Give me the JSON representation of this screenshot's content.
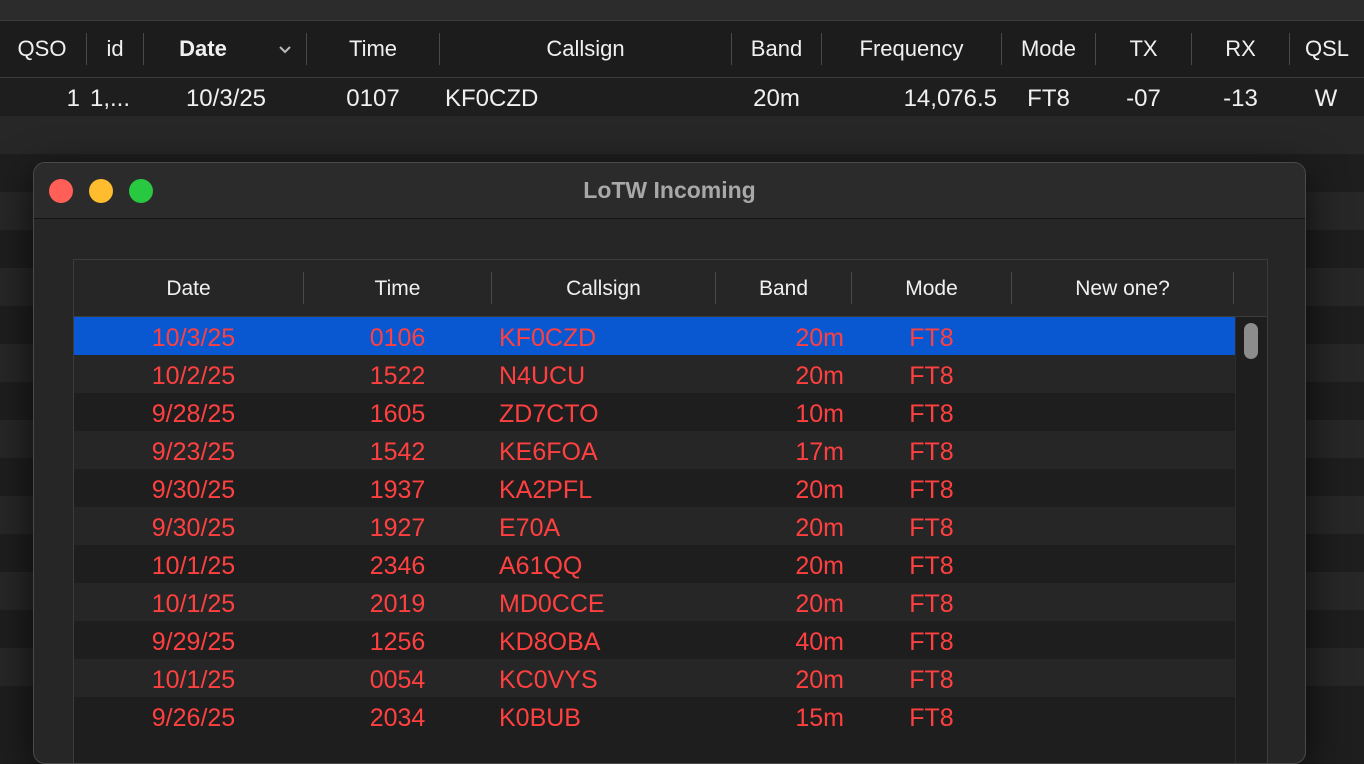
{
  "log": {
    "columns": [
      "QSO",
      "id",
      "Date",
      "Time",
      "Callsign",
      "Band",
      "Frequency",
      "Mode",
      "TX",
      "RX",
      "QSL"
    ],
    "row": {
      "qso": "1",
      "id": "1,...",
      "date": "10/3/25",
      "time": "0107",
      "callsign": "KF0CZD",
      "band": "20m",
      "frequency": "14,076.5",
      "mode": "FT8",
      "tx": "-07",
      "rx": "-13",
      "qsl": "W"
    }
  },
  "window": {
    "title": "LoTW Incoming",
    "columns": [
      "Date",
      "Time",
      "Callsign",
      "Band",
      "Mode",
      "New one?"
    ],
    "rows": [
      {
        "date": "10/3/25",
        "time": "0106",
        "callsign": "KF0CZD",
        "band": "20m",
        "mode": "FT8",
        "new_one": ""
      },
      {
        "date": "10/2/25",
        "time": "1522",
        "callsign": "N4UCU",
        "band": "20m",
        "mode": "FT8",
        "new_one": ""
      },
      {
        "date": "9/28/25",
        "time": "1605",
        "callsign": "ZD7CTO",
        "band": "10m",
        "mode": "FT8",
        "new_one": ""
      },
      {
        "date": "9/23/25",
        "time": "1542",
        "callsign": "KE6FOA",
        "band": "17m",
        "mode": "FT8",
        "new_one": ""
      },
      {
        "date": "9/30/25",
        "time": "1937",
        "callsign": "KA2PFL",
        "band": "20m",
        "mode": "FT8",
        "new_one": ""
      },
      {
        "date": "9/30/25",
        "time": "1927",
        "callsign": "E70A",
        "band": "20m",
        "mode": "FT8",
        "new_one": ""
      },
      {
        "date": "10/1/25",
        "time": "2346",
        "callsign": "A61QQ",
        "band": "20m",
        "mode": "FT8",
        "new_one": ""
      },
      {
        "date": "10/1/25",
        "time": "2019",
        "callsign": "MD0CCE",
        "band": "20m",
        "mode": "FT8",
        "new_one": ""
      },
      {
        "date": "9/29/25",
        "time": "1256",
        "callsign": "KD8OBA",
        "band": "40m",
        "mode": "FT8",
        "new_one": ""
      },
      {
        "date": "10/1/25",
        "time": "0054",
        "callsign": "KC0VYS",
        "band": "20m",
        "mode": "FT8",
        "new_one": ""
      },
      {
        "date": "9/26/25",
        "time": "2034",
        "callsign": "K0BUB",
        "band": "15m",
        "mode": "FT8",
        "new_one": ""
      }
    ],
    "selected_index": 0
  },
  "colors": {
    "row_text": "#ff4040",
    "selection": "#0958d1",
    "close": "#ff5f57",
    "minimize": "#febc2e",
    "zoom": "#28c840"
  },
  "icons": {
    "sort": "chevron-down-icon",
    "close": "close-window-icon",
    "minimize": "minimize-window-icon",
    "zoom": "zoom-window-icon"
  }
}
